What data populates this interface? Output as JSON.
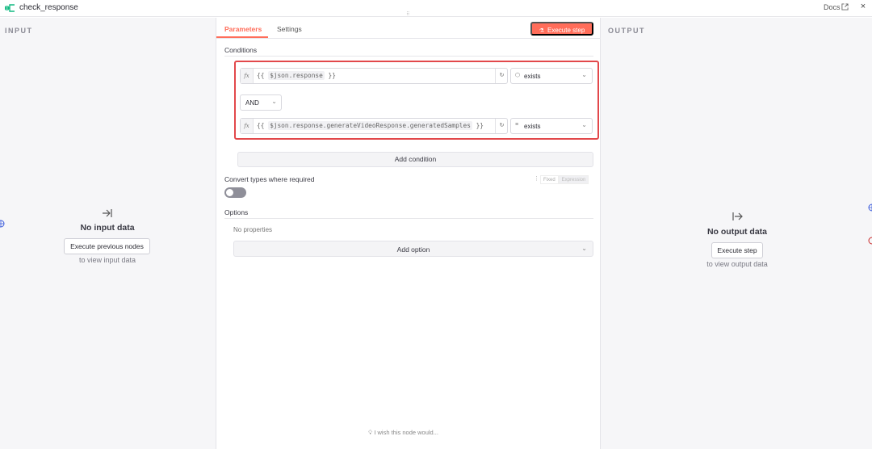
{
  "window": {
    "title": "check_response",
    "docs_label": "Docs",
    "close_icon": "×",
    "accent": "#ff6d5a",
    "node_icon_color": "#10b981"
  },
  "input": {
    "label": "INPUT",
    "empty_title": "No input data",
    "button_label": "Execute previous nodes",
    "hint": "to view input data"
  },
  "output": {
    "label": "OUTPUT",
    "empty_title": "No output data",
    "button_label": "Execute step",
    "hint": "to view output data"
  },
  "tabs": [
    {
      "label": "Parameters",
      "active": true
    },
    {
      "label": "Settings",
      "active": false
    }
  ],
  "execute_step_label": "Execute step",
  "conditions": {
    "title": "Conditions",
    "combinator": "AND",
    "rows": [
      {
        "prefix": "{{ ",
        "expression": "$json.response",
        "suffix": " }}",
        "operator_icon": "cube-icon",
        "operator": "exists"
      },
      {
        "prefix": "{{ ",
        "expression": "$json.response.generateVideoResponse.generatedSamples",
        "suffix": " }}",
        "operator_icon": "list-icon",
        "operator": "exists"
      }
    ],
    "add_label": "Add condition",
    "highlight_color": "#e2484b"
  },
  "convert_types": {
    "label": "Convert types where required",
    "enabled": false,
    "mode_fixed": "Fixed",
    "mode_expression": "Expression"
  },
  "options": {
    "title": "Options",
    "empty": "No properties",
    "add_label": "Add option"
  },
  "feedback": "I wish this node would..."
}
